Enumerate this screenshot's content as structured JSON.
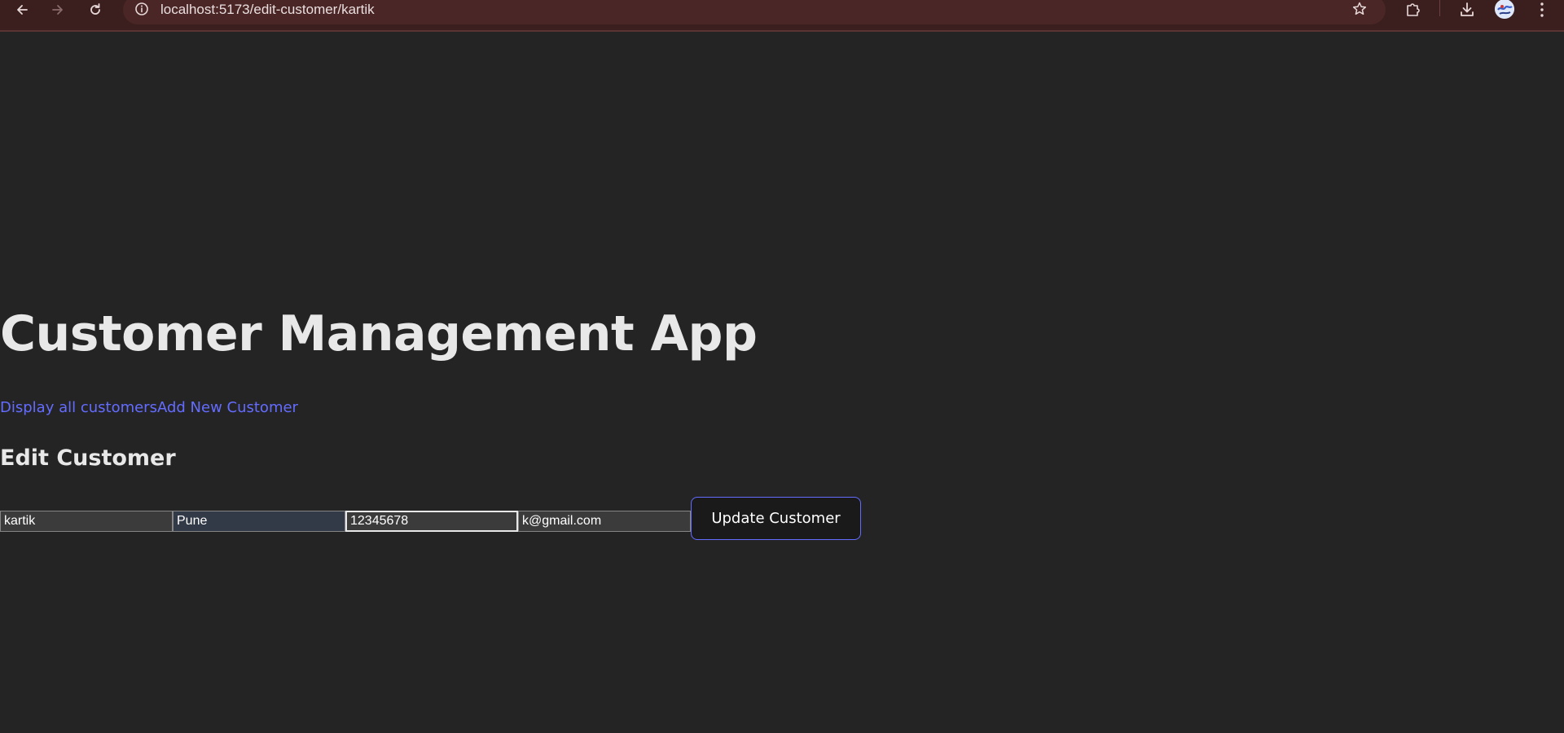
{
  "browser": {
    "url": "localhost:5173/edit-customer/kartik",
    "icons": {
      "back": "arrow-left-icon",
      "forward": "arrow-right-icon",
      "reload": "reload-icon",
      "site_info": "info-icon",
      "bookmark": "star-icon",
      "extensions": "puzzle-icon",
      "download": "download-icon",
      "profile": "avatar",
      "menu": "kebab-menu-icon"
    }
  },
  "app": {
    "title": "Customer Management App",
    "nav": {
      "display_all": "Display all customers",
      "add_new": "Add New Customer"
    },
    "section_title": "Edit Customer"
  },
  "form": {
    "name": "kartik",
    "city": "Pune",
    "phone": "12345678",
    "email": "k@gmail.com",
    "submit_label": "Update Customer"
  },
  "colors": {
    "background": "#242424",
    "link": "#646cff",
    "chrome": "#3b1f1f"
  }
}
